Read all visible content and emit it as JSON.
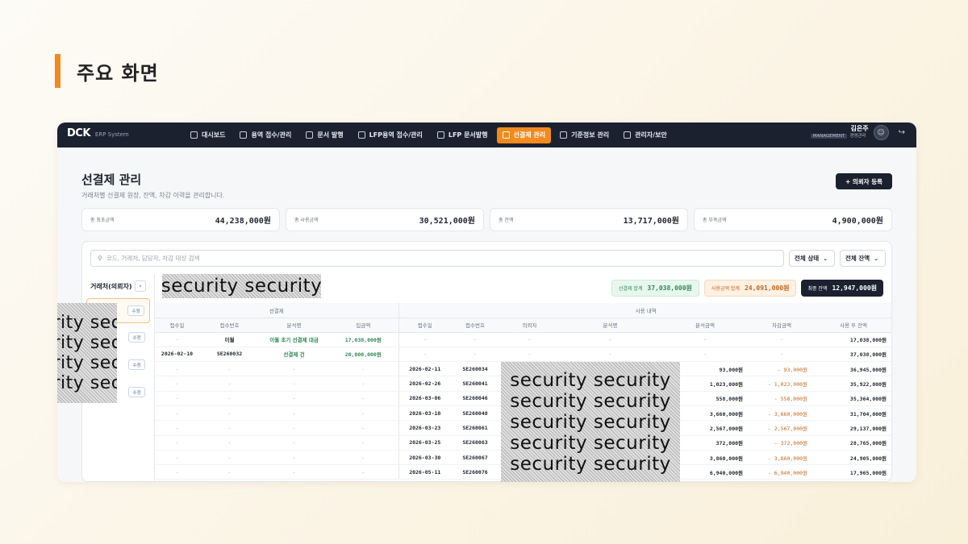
{
  "slide": {
    "title": "주요 화면"
  },
  "app": {
    "logo_main": "DCK",
    "logo_sub": "ERP System",
    "nav": [
      {
        "label": "대시보드",
        "active": false
      },
      {
        "label": "용역 접수/관리",
        "active": false
      },
      {
        "label": "문서 발행",
        "active": false
      },
      {
        "label": "LFP용역 접수/관리",
        "active": false
      },
      {
        "label": "LFP 문서발행",
        "active": false
      },
      {
        "label": "선결제 관리",
        "active": true
      },
      {
        "label": "기준정보 관리",
        "active": false
      },
      {
        "label": "관리자/보안",
        "active": false
      }
    ],
    "user": {
      "name": "김은주",
      "badge": "MANAGEMENT",
      "dept": "경영관리"
    }
  },
  "page": {
    "title": "선결제 관리",
    "subtitle": "거래처별 선결제 원장, 잔액, 차감 이력을 관리합니다.",
    "register_button": "+ 의뢰자 등록"
  },
  "summary_cards": [
    {
      "label": "총 최초금액",
      "value": "44,238,000원"
    },
    {
      "label": "총 사용금액",
      "value": "30,521,000원"
    },
    {
      "label": "총 잔액",
      "value": "13,717,000원"
    },
    {
      "label": "총 부족금액",
      "value": "4,900,000원"
    }
  ],
  "filters": {
    "search_placeholder": "코드, 거래처, 담당자, 차감 대상 검색",
    "status_select": "전체 상태",
    "balance_select": "전체 잔액"
  },
  "clients": {
    "header": "거래처(의뢰자)",
    "edit_label": "수정",
    "count": 4
  },
  "detail_sums": [
    {
      "label": "선결제 합계",
      "value": "37,038,000원"
    },
    {
      "label": "사용금액 합계",
      "value": "24,091,000원"
    },
    {
      "label": "최종 잔액",
      "value": "12,947,000원"
    }
  ],
  "watermark": "security security",
  "table": {
    "group_prepay": "선결제",
    "group_usage": "사용 내역",
    "columns": [
      "접수일",
      "접수번호",
      "분석명",
      "입금액",
      "접수일",
      "접수번호",
      "의뢰자",
      "분석명",
      "분석금액",
      "차감금액",
      "사용 후 잔액"
    ],
    "rows": [
      {
        "p_date": "-",
        "p_no": "이월",
        "p_name": "이월 초기 선결제 대금",
        "p_amt": "17,038,000원",
        "u_date": "-",
        "u_no": "-",
        "u_client": "-",
        "u_name": "-",
        "u_amt": "-",
        "u_ded": "-",
        "u_bal": "17,038,000원"
      },
      {
        "p_date": "2026-02-10",
        "p_no": "SE260032",
        "p_name": "선결제 건",
        "p_amt": "20,000,000원",
        "u_date": "-",
        "u_no": "-",
        "u_client": "-",
        "u_name": "-",
        "u_amt": "-",
        "u_ded": "-",
        "u_bal": "37,038,000원"
      },
      {
        "p_date": "-",
        "p_no": "-",
        "p_name": "-",
        "p_amt": "-",
        "u_date": "2026-02-11",
        "u_no": "SE260034",
        "u_client": "",
        "u_name": "",
        "u_amt": "93,000원",
        "u_ded": "- 93,000원",
        "u_bal": "36,945,000원"
      },
      {
        "p_date": "-",
        "p_no": "-",
        "p_name": "-",
        "p_amt": "-",
        "u_date": "2026-02-26",
        "u_no": "SE260041",
        "u_client": "",
        "u_name": "",
        "u_amt": "1,023,000원",
        "u_ded": "- 1,023,000원",
        "u_bal": "35,922,000원"
      },
      {
        "p_date": "-",
        "p_no": "-",
        "p_name": "-",
        "p_amt": "-",
        "u_date": "2026-03-06",
        "u_no": "SE260046",
        "u_client": "",
        "u_name": "",
        "u_amt": "558,000원",
        "u_ded": "- 558,000원",
        "u_bal": "35,364,000원"
      },
      {
        "p_date": "-",
        "p_no": "-",
        "p_name": "-",
        "p_amt": "-",
        "u_date": "2026-03-10",
        "u_no": "SE260048",
        "u_client": "",
        "u_name": "",
        "u_amt": "3,660,000원",
        "u_ded": "- 3,660,000원",
        "u_bal": "31,704,000원"
      },
      {
        "p_date": "-",
        "p_no": "-",
        "p_name": "-",
        "p_amt": "-",
        "u_date": "2026-03-23",
        "u_no": "SE260061",
        "u_client": "",
        "u_name": "",
        "u_amt": "2,567,000원",
        "u_ded": "- 2,567,000원",
        "u_bal": "29,137,000원"
      },
      {
        "p_date": "-",
        "p_no": "-",
        "p_name": "-",
        "p_amt": "-",
        "u_date": "2026-03-25",
        "u_no": "SE260063",
        "u_client": "",
        "u_name": "",
        "u_amt": "372,000원",
        "u_ded": "- 372,000원",
        "u_bal": "28,765,000원"
      },
      {
        "p_date": "-",
        "p_no": "-",
        "p_name": "-",
        "p_amt": "-",
        "u_date": "2026-03-30",
        "u_no": "SE260067",
        "u_client": "",
        "u_name": "",
        "u_amt": "3,860,000원",
        "u_ded": "- 3,860,000원",
        "u_bal": "24,905,000원"
      },
      {
        "p_date": "-",
        "p_no": "-",
        "p_name": "-",
        "p_amt": "-",
        "u_date": "2026-05-11",
        "u_no": "SE260076",
        "u_client": "",
        "u_name": "",
        "u_amt": "6,940,000원",
        "u_ded": "- 6,940,000원",
        "u_bal": "17,965,000원"
      }
    ]
  }
}
